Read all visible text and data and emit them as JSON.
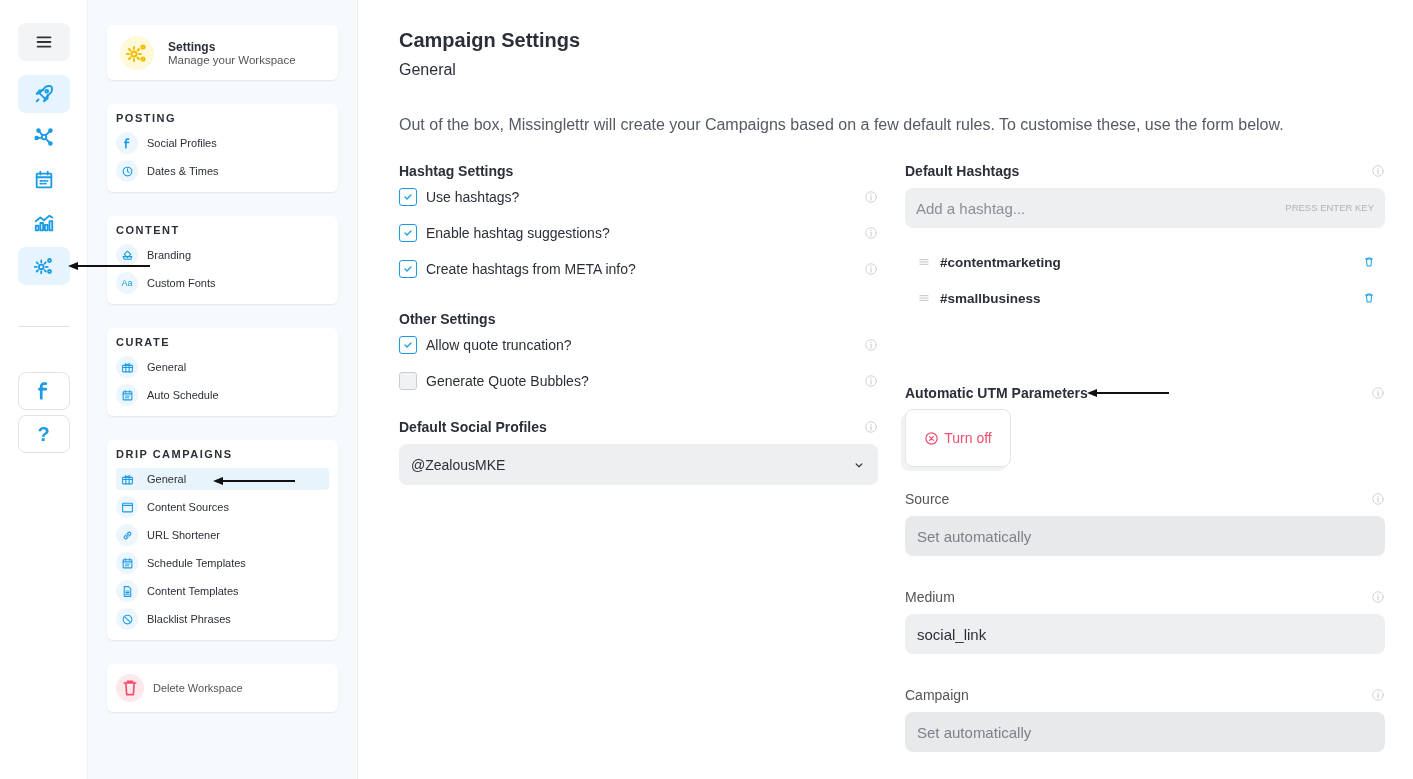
{
  "rail": {
    "top": [
      {
        "selected": false
      },
      {
        "selected": true
      },
      {
        "selected": false
      },
      {
        "selected": false
      },
      {
        "selected": false
      },
      {
        "selected": true
      }
    ],
    "bottom": [
      {
        "selected": false
      },
      {
        "selected": false,
        "label": "?"
      }
    ]
  },
  "sidebar": {
    "header": {
      "title": "Settings",
      "subtitle": "Manage your Workspace"
    },
    "sections": [
      {
        "heading": "POSTING",
        "items": [
          {
            "label": "Social Profiles",
            "selected": false
          },
          {
            "label": "Dates & Times",
            "selected": false
          }
        ]
      },
      {
        "heading": "CONTENT",
        "items": [
          {
            "label": "Branding",
            "selected": false
          },
          {
            "label": "Custom Fonts",
            "selected": false,
            "icon_text": "Aa"
          }
        ]
      },
      {
        "heading": "CURATE",
        "items": [
          {
            "label": "General",
            "selected": false
          },
          {
            "label": "Auto Schedule",
            "selected": false
          }
        ]
      },
      {
        "heading": "DRIP CAMPAIGNS",
        "items": [
          {
            "label": "General",
            "selected": true
          },
          {
            "label": "Content Sources",
            "selected": false
          },
          {
            "label": "URL Shortener",
            "selected": false
          },
          {
            "label": "Schedule Templates",
            "selected": false
          },
          {
            "label": "Content Templates",
            "selected": false
          },
          {
            "label": "Blacklist Phrases",
            "selected": false
          }
        ]
      }
    ],
    "delete": "Delete Workspace"
  },
  "main": {
    "title": "Campaign Settings",
    "subtitle": "General",
    "intro": "Out of the box, Missinglettr will create your Campaigns based on a few default rules. To customise these, use the form below.",
    "groups": [
      {
        "heading": "Hashtag Settings",
        "options": [
          {
            "label": "Use hashtags?",
            "checked": true
          },
          {
            "label": "Enable hashtag suggestions?",
            "checked": true
          },
          {
            "label": "Create hashtags from META info?",
            "checked": true
          }
        ]
      },
      {
        "heading": "Other Settings",
        "options": [
          {
            "label": "Allow quote truncation?",
            "checked": true
          },
          {
            "label": "Generate Quote Bubbles?",
            "checked": false
          }
        ]
      }
    ],
    "profiles": {
      "label": "Default Social Profiles",
      "value": "@ZealousMKE"
    },
    "hashtags": {
      "label": "Default Hashtags",
      "placeholder": "Add a hashtag...",
      "hint": "PRESS ENTER KEY",
      "tags": [
        "#contentmarketing",
        "#smallbusiness"
      ]
    },
    "utm": {
      "label": "Automatic UTM Parameters",
      "button": "Turn off",
      "fields": [
        {
          "label": "Source",
          "placeholder": "Set automatically"
        },
        {
          "label": "Medium",
          "value": "social_link"
        },
        {
          "label": "Campaign",
          "placeholder": "Set automatically"
        }
      ]
    }
  }
}
